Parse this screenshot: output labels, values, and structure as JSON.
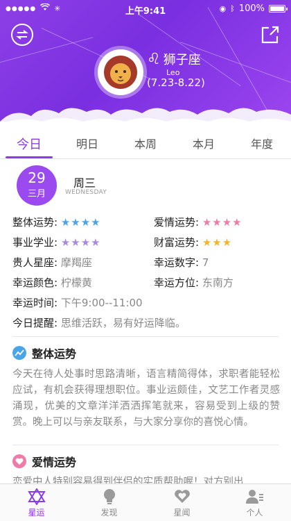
{
  "status_bar": {
    "signal": "●●●●●",
    "time": "上午9:41",
    "battery": "100%"
  },
  "header": {
    "sign_symbol": "♌",
    "sign_name": "狮子座",
    "sign_en": "Leo",
    "sign_dates": "(7.23-8.22)"
  },
  "tabs": [
    "今日",
    "明日",
    "本周",
    "本月",
    "年度"
  ],
  "date": {
    "day": "29",
    "month": "三月",
    "weekday_cn": "周三",
    "weekday_en": "WEDNESDAY"
  },
  "fortune": {
    "overall_label": "整体运势:",
    "overall_stars": "★★★★",
    "love_label": "爱情运势:",
    "love_stars": "★★★★",
    "career_label": "事业学业:",
    "career_stars": "★★★★",
    "wealth_label": "财富运势:",
    "wealth_stars": "★★★",
    "noble_label": "贵人星座:",
    "noble_value": "摩羯座",
    "number_label": "幸运数字:",
    "number_value": "7",
    "color_label": "幸运颜色:",
    "color_value": "柠檬黄",
    "direction_label": "幸运方位:",
    "direction_value": "东南方",
    "time_label": "幸运时间:",
    "time_value": "下午9:00--11:00",
    "reminder_label": "今日提醒:",
    "reminder_value": "思维活跃，易有好运降临。"
  },
  "sections": {
    "overall_title": "整体运势",
    "overall_text": "今天在待人处事时思路清晰，语言精简得体，求职者能轻松应试，有机会获得理想职位。事业运颇佳，文艺工作者灵感涌现，优美的文章洋洋洒洒挥笔就来，容易受到上级的赞赏。晚上可以与亲友联系，与大家分享你的喜悦心情。",
    "love_title": "爱情运势",
    "love_text": "恋爱中人特别容易得到伴侣的实质帮助喔！对方别出"
  },
  "bottom_nav": [
    "星运",
    "发现",
    "星闻",
    "个人"
  ],
  "colors": {
    "accent": "#8a3ce6",
    "star_blue": "#4aa4e8",
    "star_purple": "#a88be0",
    "star_pink": "#f07aa8",
    "star_gold": "#f3b42c"
  }
}
